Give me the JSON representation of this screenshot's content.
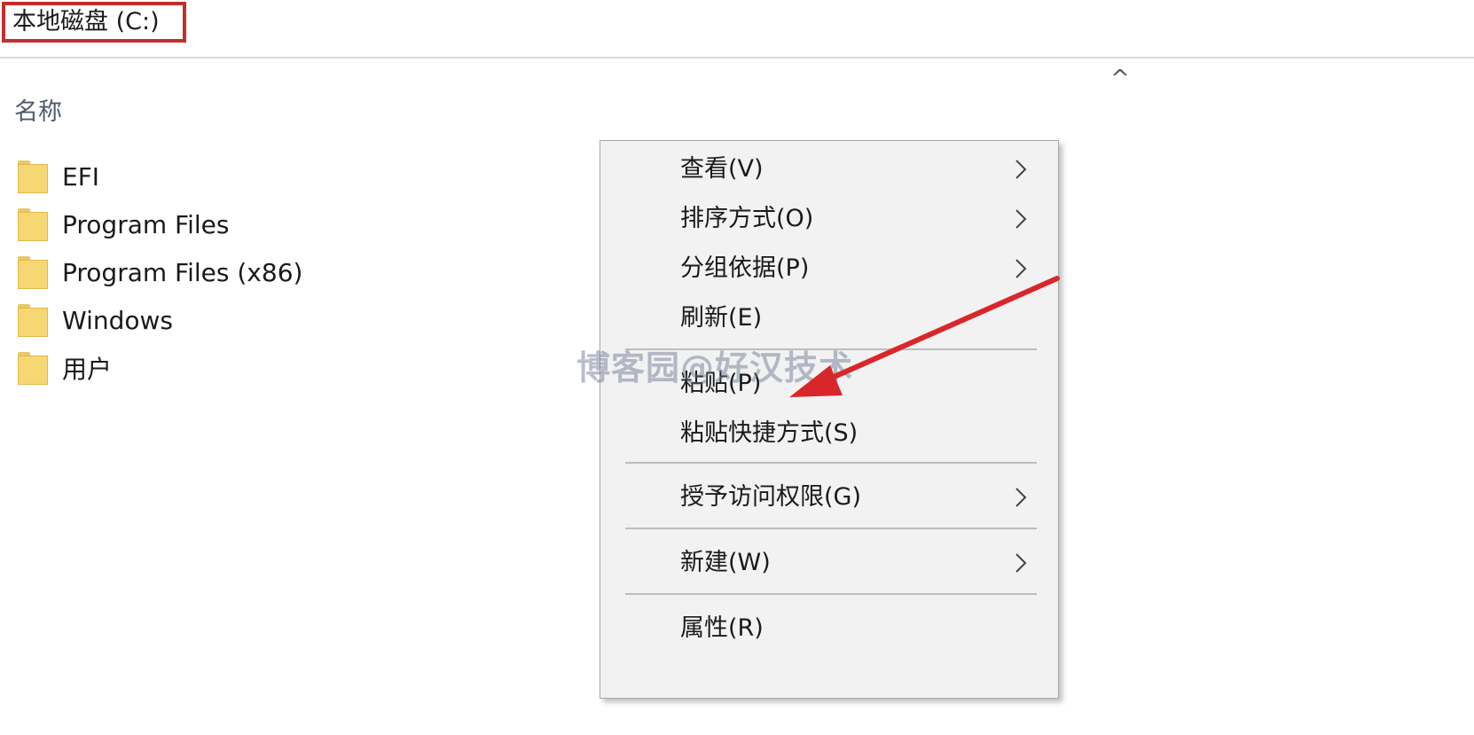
{
  "header": {
    "title": "本地磁盘 (C:)",
    "column_name": "名称",
    "sort_indicator": "^"
  },
  "files": [
    {
      "name": "EFI",
      "icon": "folder-icon"
    },
    {
      "name": "Program Files",
      "icon": "folder-icon"
    },
    {
      "name": "Program Files (x86)",
      "icon": "folder-icon"
    },
    {
      "name": "Windows",
      "icon": "folder-icon"
    },
    {
      "name": "用户",
      "icon": "folder-icon"
    }
  ],
  "context_menu": {
    "view": "查看(V)",
    "sort_by": "排序方式(O)",
    "group_by": "分组依据(P)",
    "refresh": "刷新(E)",
    "paste": "粘贴(P)",
    "paste_shortcut": "粘贴快捷方式(S)",
    "give_access": "授予访问权限(G)",
    "new": "新建(W)",
    "properties": "属性(R)"
  },
  "watermark": "博客园@好汉技术",
  "colors": {
    "highlight_border": "#c0302b",
    "annotation_arrow": "#d9262b",
    "menu_background": "#f2f2f2",
    "folder": "#f7d774"
  }
}
